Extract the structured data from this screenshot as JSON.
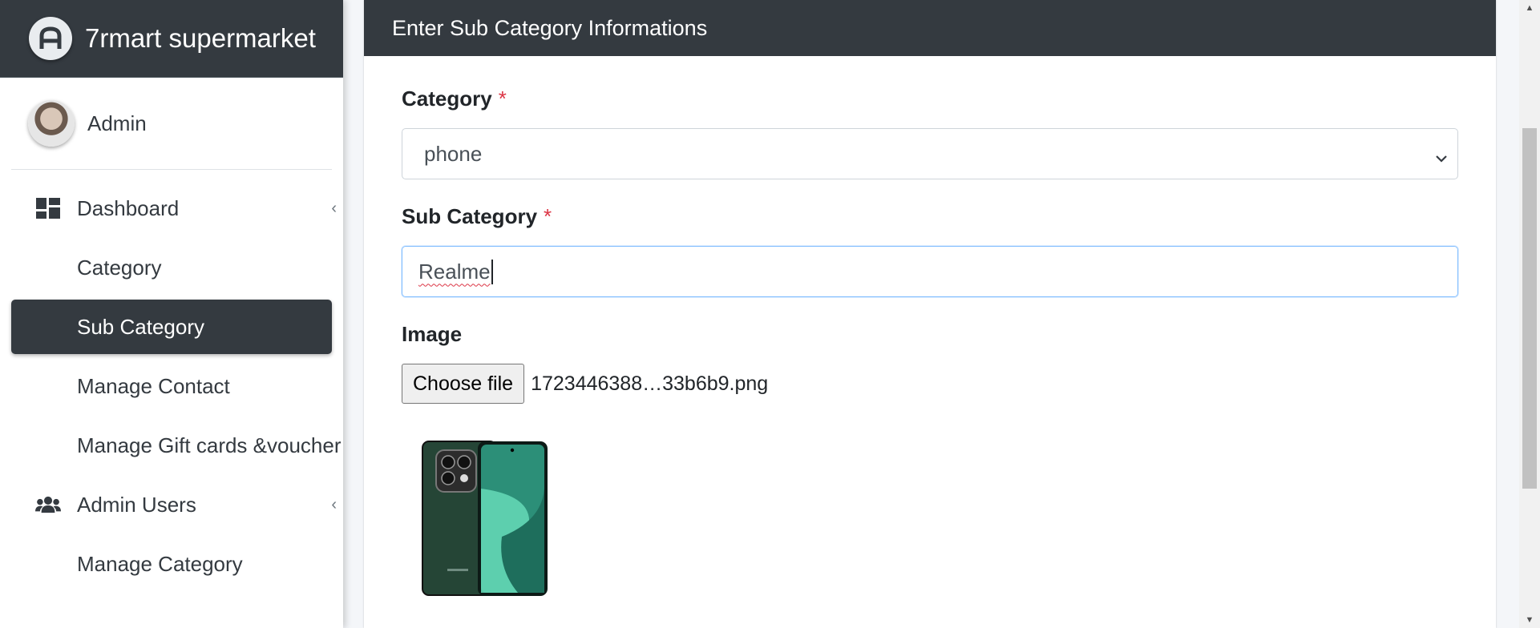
{
  "brand": {
    "name": "7rmart supermarket",
    "logo_icon": "brand-logo-icon"
  },
  "user": {
    "name": "Admin"
  },
  "sidebar": {
    "items": [
      {
        "label": "Dashboard",
        "icon": "dashboard-grid-icon",
        "caret": "‹"
      },
      {
        "label": "Category"
      },
      {
        "label": "Sub Category",
        "active": true
      },
      {
        "label": "Manage Contact"
      },
      {
        "label": "Manage Gift cards &voucher"
      },
      {
        "label": "Admin Users",
        "icon": "users-icon",
        "caret": "‹"
      },
      {
        "label": "Manage Category"
      }
    ]
  },
  "card": {
    "title": "Enter Sub Category Informations"
  },
  "form": {
    "category_label": "Category",
    "category_value": "phone",
    "subcategory_label": "Sub Category",
    "subcategory_value": "Realme",
    "required_mark": "*",
    "image_label": "Image",
    "choose_file_label": "Choose file",
    "file_name": "1723446388…33b6b9.png"
  },
  "colors": {
    "dark": "#343a40",
    "required": "#dc3545",
    "focus_border": "#80bdff"
  }
}
